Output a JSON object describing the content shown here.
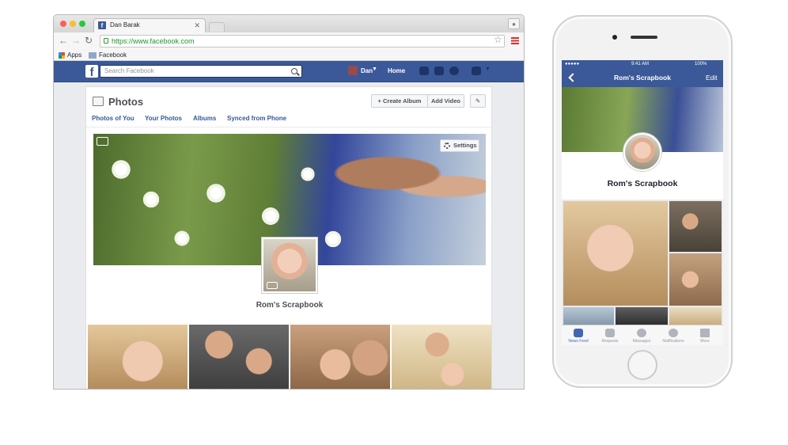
{
  "browser": {
    "tab_title": "Dan Barak",
    "url": "https://www.facebook.com",
    "bookmarks": {
      "apps": "Apps",
      "facebook": "Facebook"
    }
  },
  "facebook": {
    "search_placeholder": "Search Facebook",
    "user_name": "Dan",
    "home_label": "Home",
    "page_title": "Photos",
    "create_album": "+ Create Album",
    "add_video": "Add Video",
    "subtabs": [
      "Photos of You",
      "Your Photos",
      "Albums",
      "Synced from Phone"
    ],
    "settings_label": "Settings",
    "album_title": "Rom's Scrapbook"
  },
  "phone": {
    "status_time": "9:41 AM",
    "battery": "100%",
    "nav_title": "Rom's Scrapbook",
    "nav_edit": "Edit",
    "album_title": "Rom's Scrapbook",
    "tabs": [
      "News Feed",
      "Requests",
      "Messages",
      "Notifications",
      "More"
    ]
  },
  "colors": {
    "facebook_blue": "#3b5998",
    "link_blue": "#365899",
    "active_tab": "#4267b2"
  }
}
